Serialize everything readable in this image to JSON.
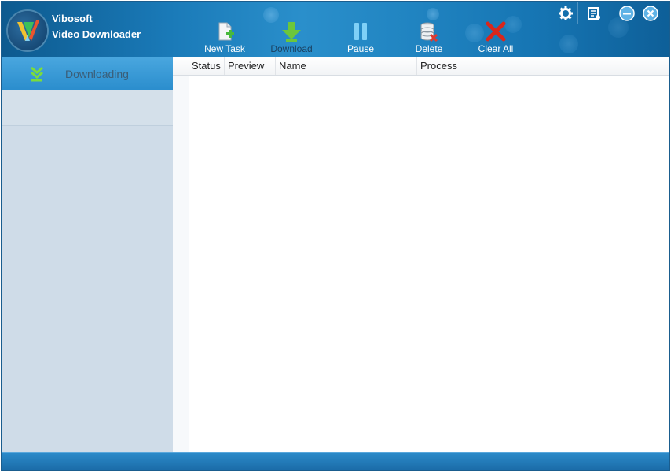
{
  "app": {
    "title_line1": "Vibosoft",
    "title_line2": "Video Downloader"
  },
  "toolbar": [
    {
      "id": "new-task",
      "label": "New Task",
      "icon": "new-task-icon"
    },
    {
      "id": "download",
      "label": "Download",
      "icon": "download-icon"
    },
    {
      "id": "pause",
      "label": "Pause",
      "icon": "pause-icon"
    },
    {
      "id": "delete",
      "label": "Delete",
      "icon": "delete-icon"
    },
    {
      "id": "clear-all",
      "label": "Clear All",
      "icon": "clear-all-icon"
    }
  ],
  "system_buttons": [
    "settings-icon",
    "register-icon",
    "minimize-icon",
    "close-icon"
  ],
  "sidebar": {
    "items": [
      {
        "label": "Downloading",
        "icon": "downloading-icon",
        "active": true
      }
    ]
  },
  "table": {
    "columns": [
      "Status",
      "Preview",
      "Name",
      "Process"
    ],
    "rows": []
  },
  "colors": {
    "titlebar": "#1a7ab8",
    "sidebar": "#cfdce8",
    "active_item": "#3a9ad6",
    "statusbar": "#1f74b1"
  }
}
